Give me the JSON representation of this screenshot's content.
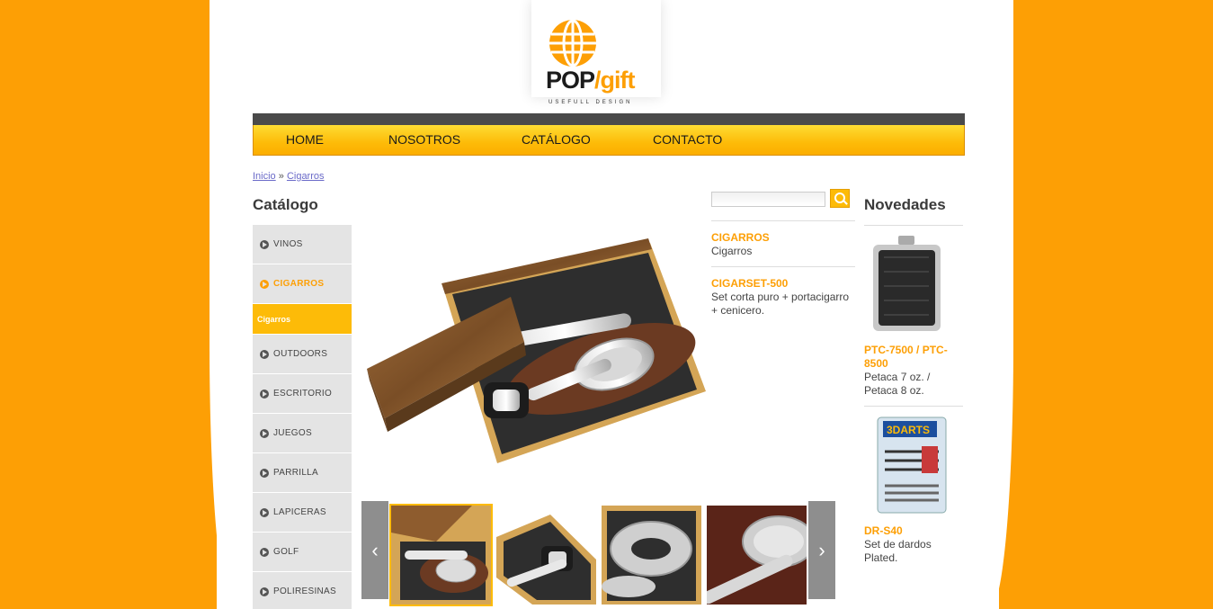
{
  "logo": {
    "pop": "POP",
    "slash": "/",
    "gift": "gift",
    "tagline": "USEFULL DESIGN"
  },
  "nav": {
    "items": [
      "HOME",
      "NOSOTROS",
      "CATÁLOGO",
      "CONTACTO"
    ]
  },
  "breadcrumb": {
    "home": "Inicio",
    "separator": "»",
    "current": "Cigarros"
  },
  "sidebar": {
    "title": "Catálogo",
    "items": [
      "VINOS",
      "CIGARROS",
      "OUTDOORS",
      "ESCRITORIO",
      "JUEGOS",
      "PARRILLA",
      "LAPICERAS",
      "GOLF",
      "POLIRESINAS"
    ],
    "active_item": "CIGARROS",
    "sub_item": "Cigarros"
  },
  "search": {
    "placeholder": "",
    "button_icon": "magnifier-icon"
  },
  "details": {
    "category_title": "CIGARROS",
    "category_text": "Cigarros",
    "product_code": "CIGARSET-500",
    "product_desc": "Set corta puro + portacigarro + cenicero."
  },
  "thumbnails": {
    "prev_icon": "chevron-left-icon",
    "next_icon": "chevron-right-icon",
    "count": 4
  },
  "novedades": {
    "title": "Novedades",
    "items": [
      {
        "code": "PTC-7500 / PTC-8500",
        "desc": "Petaca 7 oz. / Petaca 8 oz."
      },
      {
        "code": "DR-S40",
        "desc": "Set de dardos Plated."
      }
    ]
  },
  "colors": {
    "accent": "#fd9f05",
    "nav_yellow": "#fdbb08",
    "nav_dark": "#4a4a4a"
  }
}
